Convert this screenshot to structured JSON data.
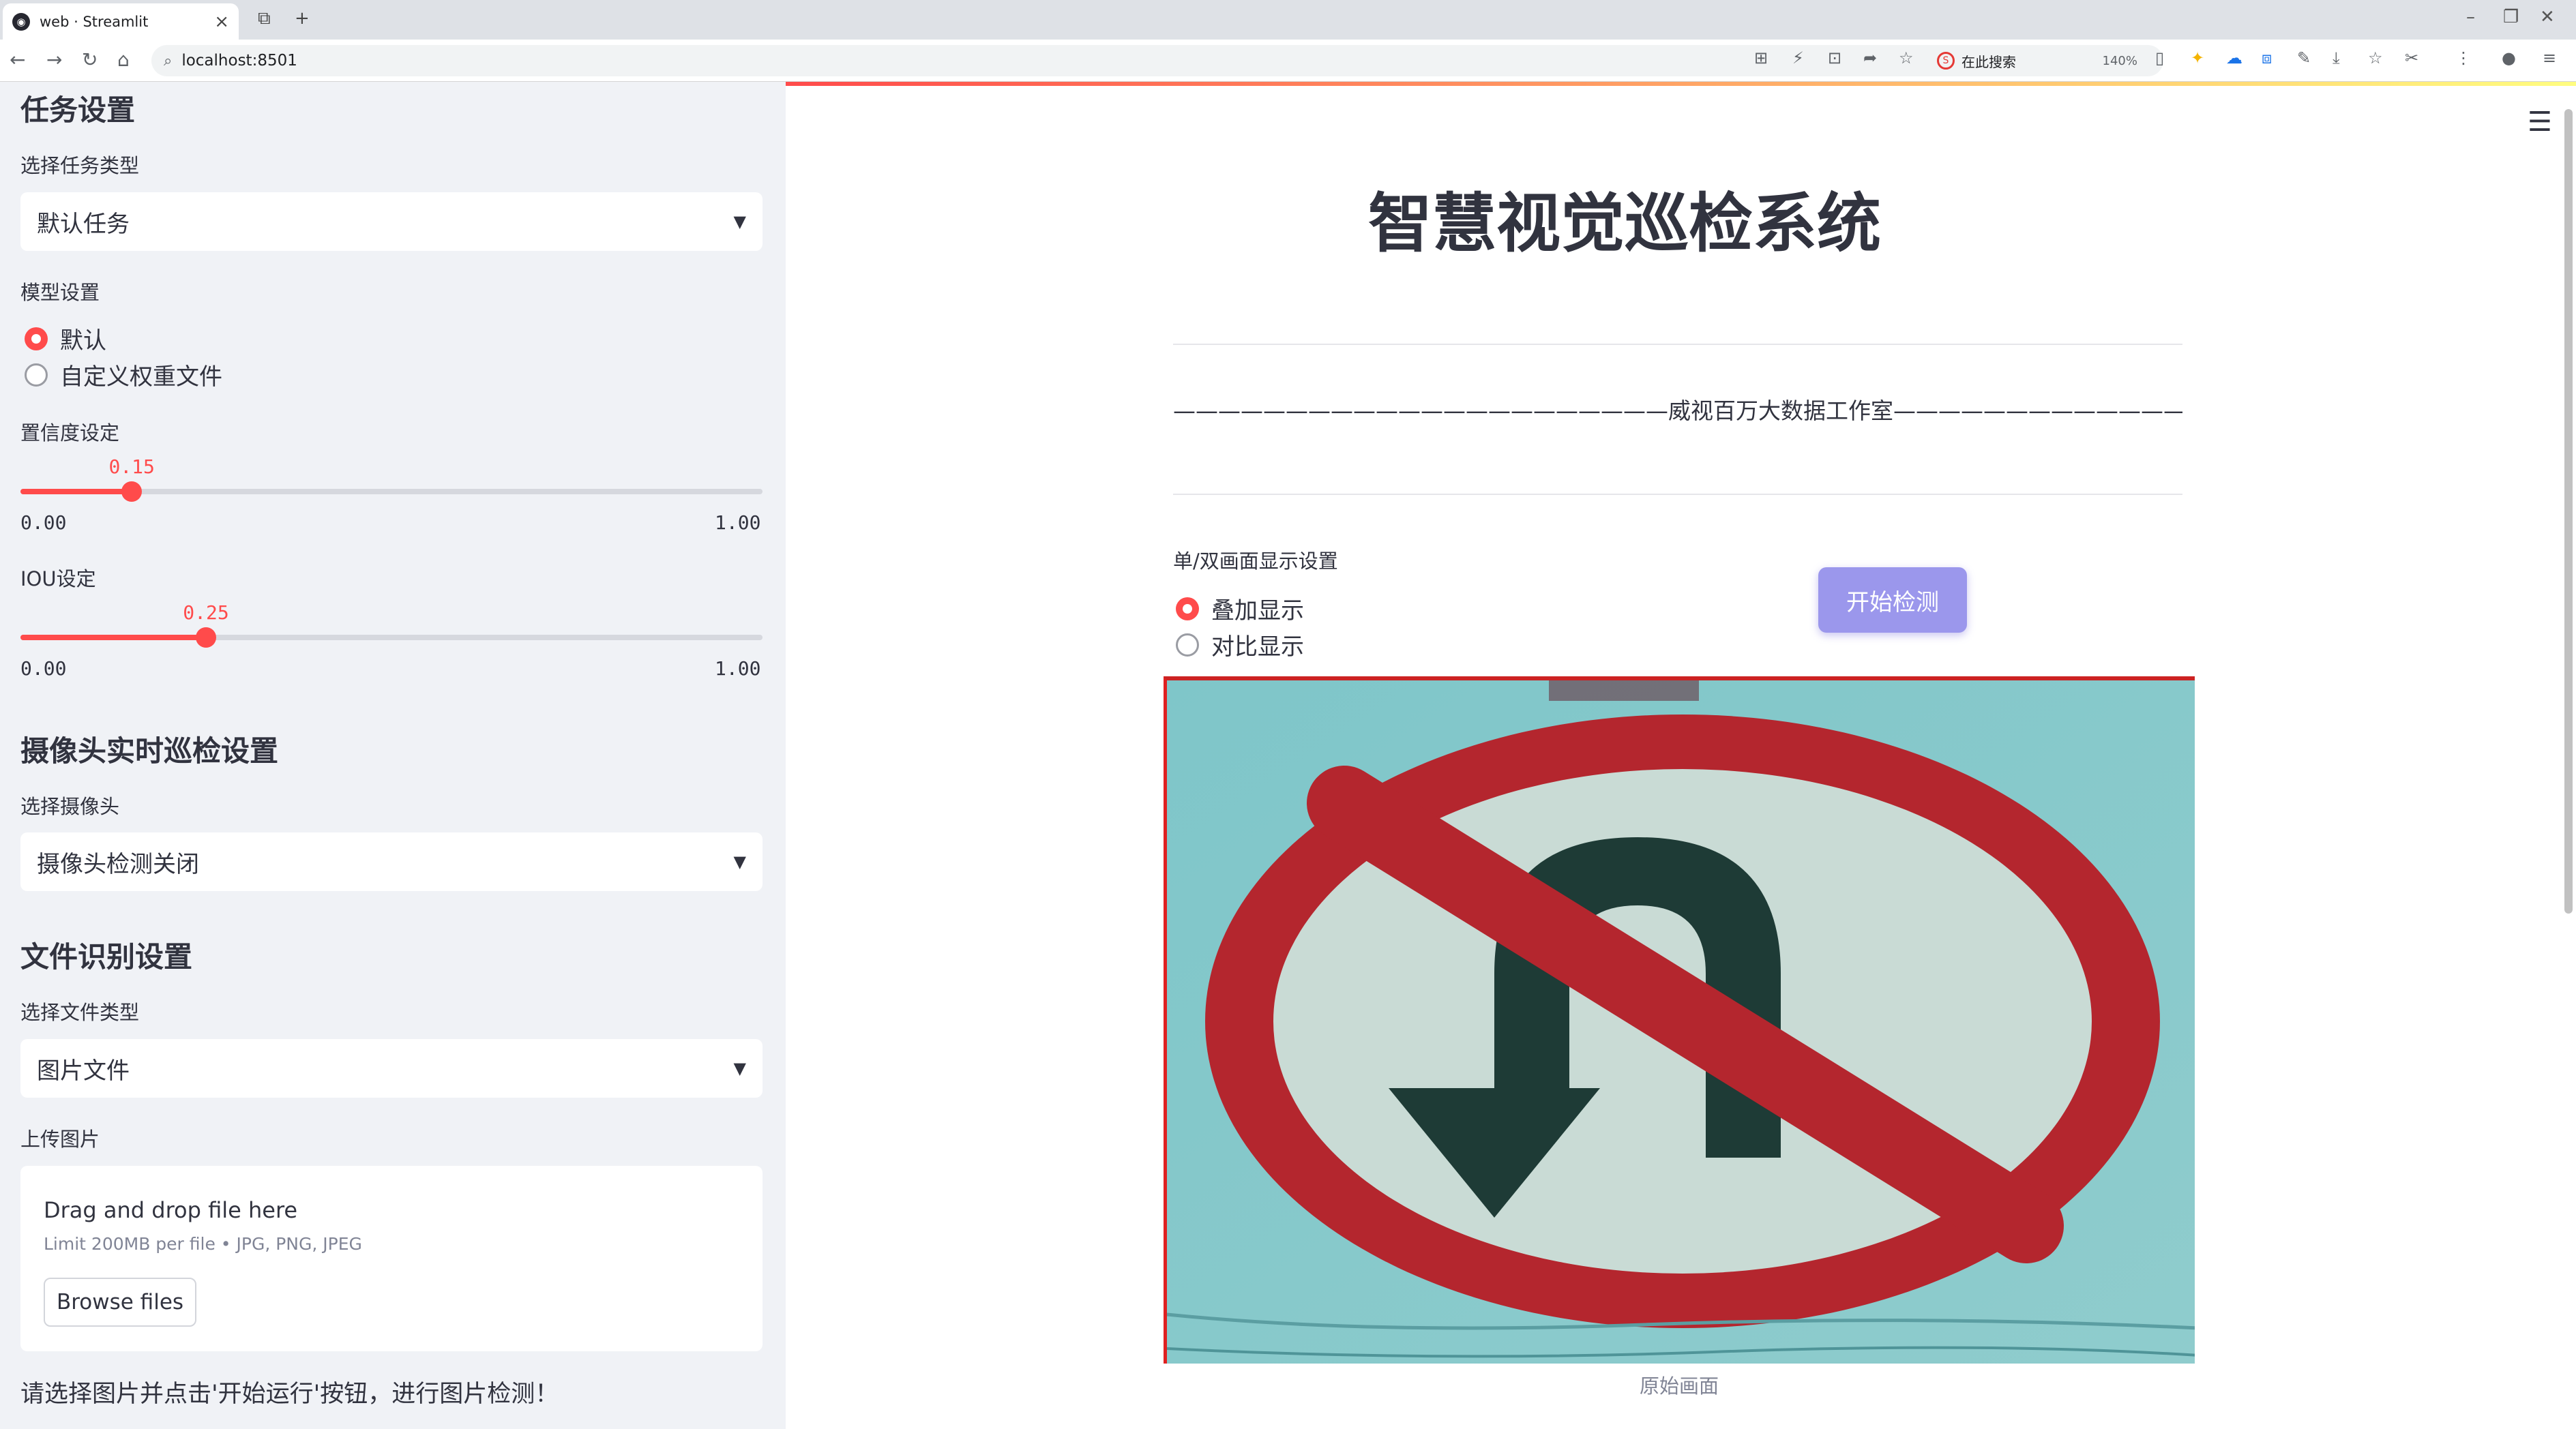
{
  "browser": {
    "tab_title": "web · Streamlit",
    "url": "localhost:8501",
    "zoom": "140%",
    "search_placeholder": "在此搜索"
  },
  "sidebar": {
    "task_heading": "任务设置",
    "task_type_label": "选择任务类型",
    "task_type_value": "默认任务",
    "model_label": "模型设置",
    "model_options": [
      "默认",
      "自定义权重文件"
    ],
    "model_selected": "默认",
    "confidence": {
      "label": "置信度设定",
      "value": "0.15",
      "min": "0.00",
      "max": "1.00",
      "fraction": 0.15
    },
    "iou": {
      "label": "IOU设定",
      "value": "0.25",
      "min": "0.00",
      "max": "1.00",
      "fraction": 0.25
    },
    "camera_heading": "摄像头实时巡检设置",
    "camera_label": "选择摄像头",
    "camera_value": "摄像头检测关闭",
    "file_heading": "文件识别设置",
    "file_type_label": "选择文件类型",
    "file_type_value": "图片文件",
    "upload_label": "上传图片",
    "upload_dd": "Drag and drop file here",
    "upload_limit": "Limit 200MB per file • JPG, PNG, JPEG",
    "browse_label": "Browse files",
    "hint": "请选择图片并点击'开始运行'按钮，进行图片检测！"
  },
  "main": {
    "title": "智慧视觉巡检系统",
    "studio_line": "——————————————————————威视百万大数据工作室———————————————————————",
    "display_label": "单/双画面显示设置",
    "display_options": [
      "叠加显示",
      "对比显示"
    ],
    "display_selected": "叠加显示",
    "start_button": "开始检测",
    "caption": "原始画面"
  },
  "colors": {
    "accent": "#ff4b4b",
    "button": "#9b97ec",
    "sidebar_bg": "#f0f2f6"
  }
}
